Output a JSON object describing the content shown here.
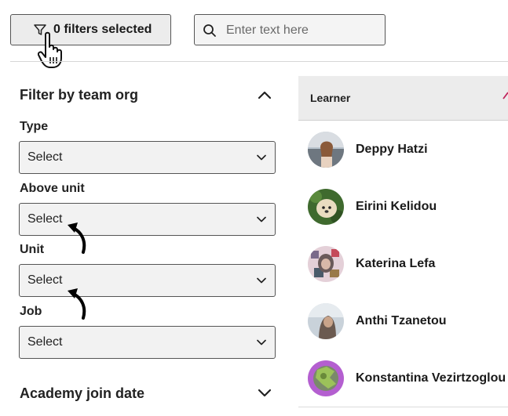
{
  "toolbar": {
    "filter_button_label": "0 filters selected",
    "search_placeholder": "Enter text here"
  },
  "filter_panel": {
    "team_org_title": "Filter by team org",
    "fields": [
      {
        "label": "Type",
        "value": "Select"
      },
      {
        "label": "Above unit",
        "value": "Select"
      },
      {
        "label": "Unit",
        "value": "Select"
      },
      {
        "label": "Job",
        "value": "Select"
      }
    ],
    "academy_join_date_title": "Academy join date"
  },
  "table": {
    "column_header": "Learner",
    "rows": [
      {
        "name": "Deppy Hatzi"
      },
      {
        "name": "Eirini Kelidou"
      },
      {
        "name": "Katerina Lefa"
      },
      {
        "name": "Anthi Tzanetou"
      },
      {
        "name": "Konstantina Vezirtzoglou"
      }
    ]
  },
  "colors": {
    "border": "#555555",
    "button_bg": "#ececec",
    "table_header_bg": "#ececec",
    "sort_accent": "#c0245c"
  }
}
